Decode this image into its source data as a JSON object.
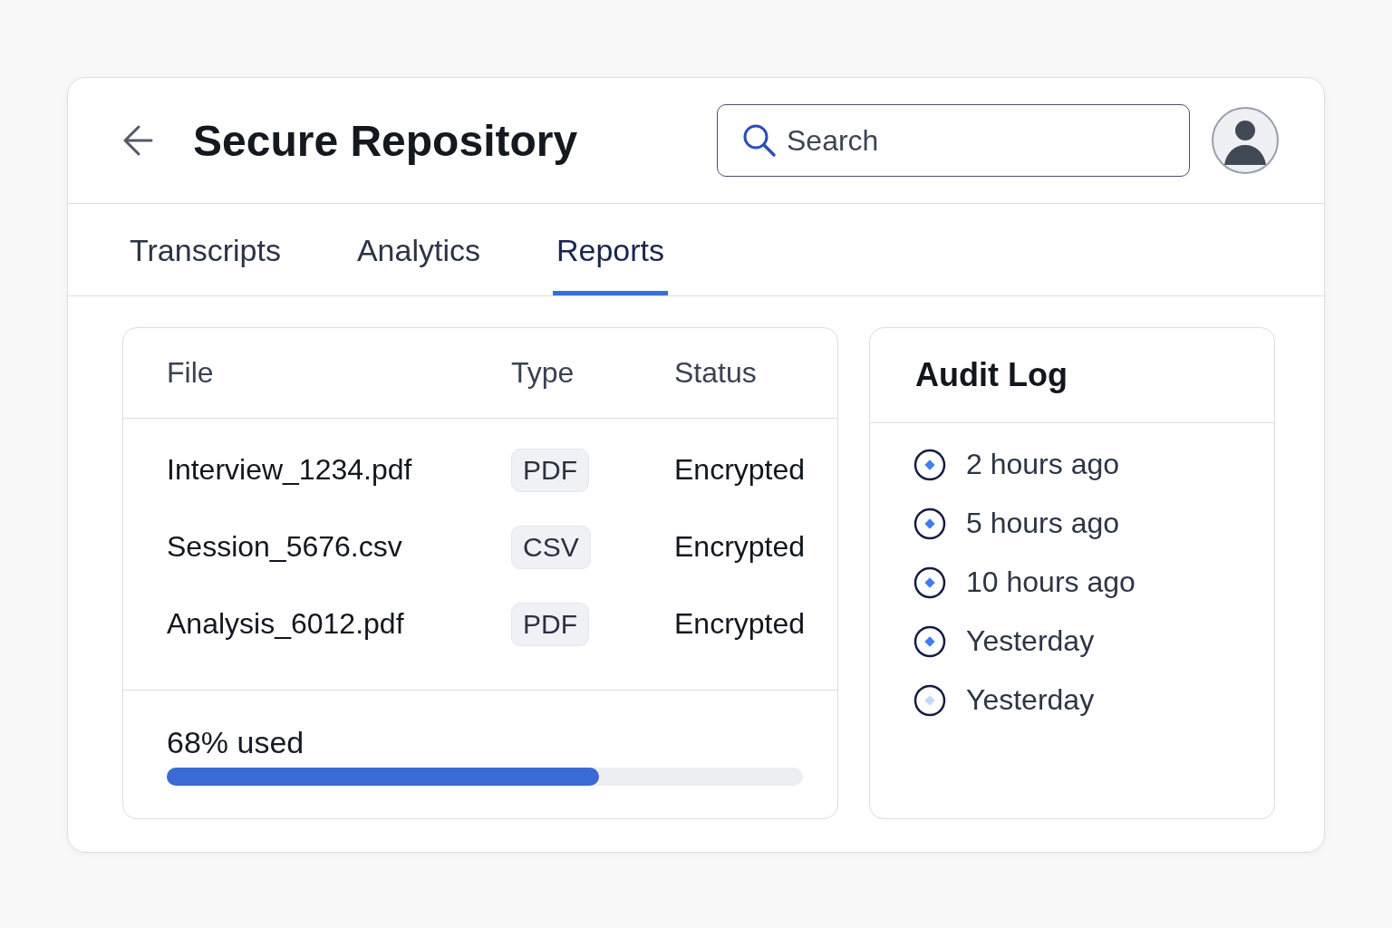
{
  "header": {
    "title": "Secure Repository",
    "search": {
      "placeholder": "Search"
    }
  },
  "tabs": [
    {
      "label": "Transcripts",
      "selected": false
    },
    {
      "label": "Analytics",
      "selected": false
    },
    {
      "label": "Reports",
      "selected": true
    }
  ],
  "table": {
    "columns": [
      "File",
      "Type",
      "Status"
    ],
    "rows": [
      {
        "file": "Interview_1234.pdf",
        "type": "PDF",
        "status": "Encrypted"
      },
      {
        "file": "Session_5676.csv",
        "type": "CSV",
        "status": "Encrypted"
      },
      {
        "file": "Analysis_6012.pdf",
        "type": "PDF",
        "status": "Encrypted"
      }
    ]
  },
  "storage": {
    "label": "68% used",
    "level": 0.68
  },
  "audit_log": {
    "title": "Audit Log",
    "entries": [
      {
        "time": "2 hours ago",
        "dimmed": false
      },
      {
        "time": "5 hours ago",
        "dimmed": false
      },
      {
        "time": "10 hours ago",
        "dimmed": false
      },
      {
        "time": "Yesterday",
        "dimmed": false
      },
      {
        "time": "Yesterday",
        "dimmed": true
      }
    ]
  }
}
